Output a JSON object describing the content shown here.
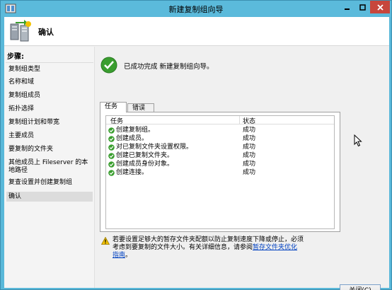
{
  "window": {
    "title": "新建复制组向导"
  },
  "header": {
    "title": "确认"
  },
  "sidebar": {
    "heading": "步骤:",
    "steps": [
      "复制组类型",
      "名称和域",
      "复制组成员",
      "拓扑选择",
      "复制组计划和带宽",
      "主要成员",
      "要复制的文件夹",
      "其他成员上 Fileserver 的本地路径",
      "复查设置并创建复制组",
      "确认"
    ],
    "current_step": "确认"
  },
  "main": {
    "success_message": "已成功完成 新建复制组向导。",
    "tabs": [
      "任务",
      "错误"
    ],
    "active_tab": "任务",
    "table": {
      "columns": [
        "任务",
        "状态"
      ],
      "rows": [
        {
          "task": "创建复制组。",
          "status": "成功"
        },
        {
          "task": "创建成员。",
          "status": "成功"
        },
        {
          "task": "对已复制文件夹设置权限。",
          "status": "成功"
        },
        {
          "task": "创建已复制文件夹。",
          "status": "成功"
        },
        {
          "task": "创建成员身份对象。",
          "status": "成功"
        },
        {
          "task": "创建连接。",
          "status": "成功"
        }
      ]
    },
    "warning": {
      "text": "若要设置足够大的暂存文件夹配额以防止复制速度下降或停止，必须考虑到要复制的文件大小。有关详细信息，请参阅",
      "link": "暂存文件夹优化指南",
      "suffix": "。"
    }
  },
  "footer": {
    "close_label": "关闭(C)"
  },
  "colors": {
    "titlebar": "#5bbadb",
    "success": "#3a9e2f",
    "close_button": "#c7463c",
    "warning": "#f2c200"
  }
}
